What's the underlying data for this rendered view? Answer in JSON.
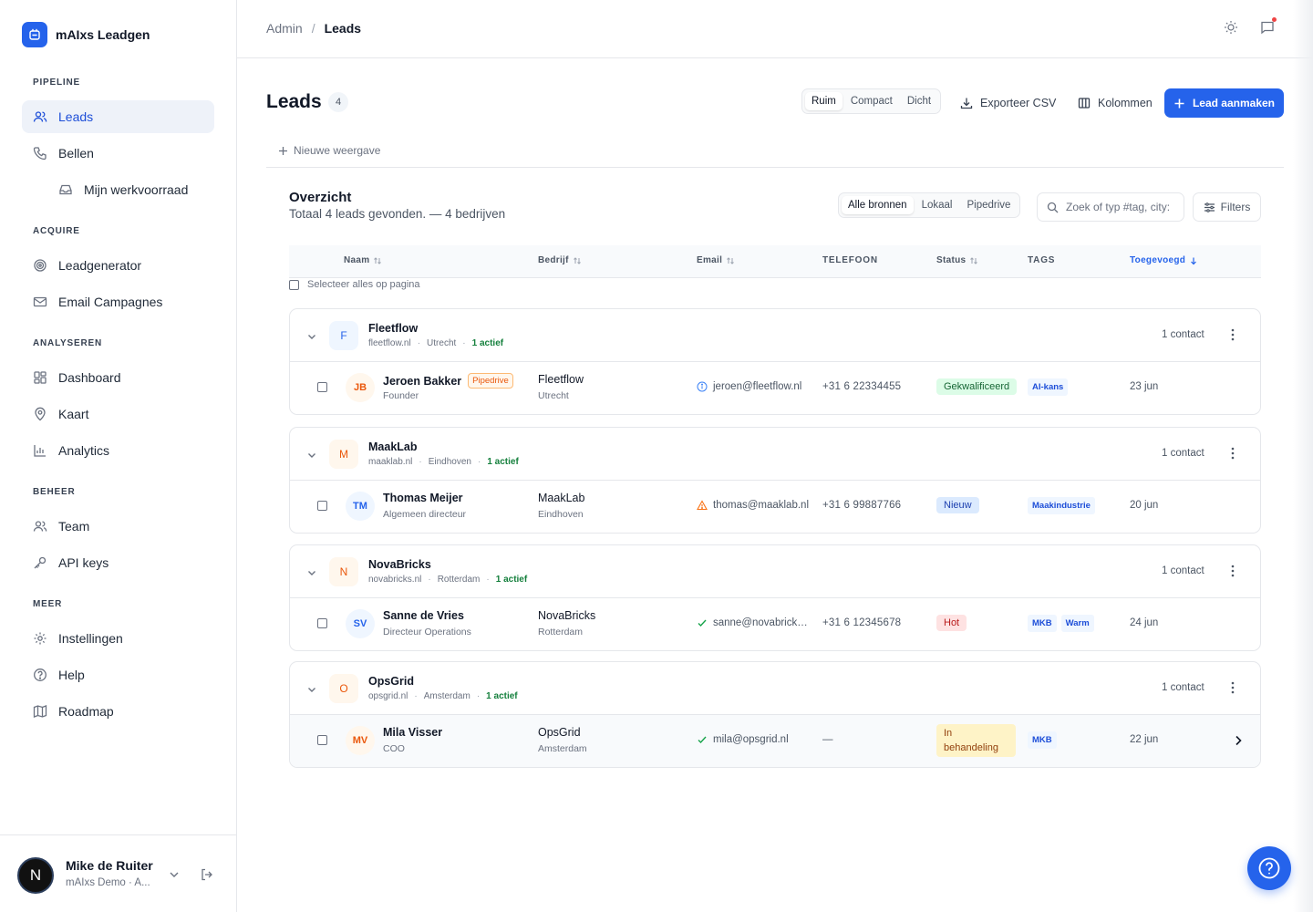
{
  "brand": {
    "name": "mAIxs Leadgen"
  },
  "sidebar": {
    "sections": [
      {
        "title": "PIPELINE",
        "items": [
          {
            "label": "Leads",
            "icon": "users-icon",
            "active": true
          },
          {
            "label": "Bellen",
            "icon": "phone-icon"
          },
          {
            "label": "Mijn werkvoorraad",
            "icon": "inbox-icon"
          }
        ]
      },
      {
        "title": "ACQUIRE",
        "items": [
          {
            "label": "Leadgenerator",
            "icon": "target-icon"
          },
          {
            "label": "Email Campagnes",
            "icon": "mail-icon"
          }
        ]
      },
      {
        "title": "ANALYSEREN",
        "items": [
          {
            "label": "Dashboard",
            "icon": "dashboard-icon"
          },
          {
            "label": "Kaart",
            "icon": "map-pin-icon"
          },
          {
            "label": "Analytics",
            "icon": "bar-chart-icon"
          }
        ]
      },
      {
        "title": "BEHEER",
        "items": [
          {
            "label": "Team",
            "icon": "team-icon"
          },
          {
            "label": "API keys",
            "icon": "key-icon"
          }
        ]
      },
      {
        "title": "MEER",
        "items": [
          {
            "label": "Instellingen",
            "icon": "gear-icon"
          },
          {
            "label": "Help",
            "icon": "help-circle-icon"
          },
          {
            "label": "Roadmap",
            "icon": "map-icon"
          }
        ]
      }
    ],
    "user": {
      "initial": "N",
      "name": "Mike de Ruiter",
      "org": "mAIxs Demo · A..."
    }
  },
  "topbar": {
    "breadcrumb": [
      "Admin",
      "/",
      "Leads"
    ]
  },
  "page": {
    "title": "Leads",
    "count": "4",
    "density": [
      "Ruim",
      "Compact",
      "Dicht"
    ],
    "export_label": "Exporteer CSV",
    "columns_label": "Kolommen",
    "create_label": "Lead aanmaken",
    "new_view_label": "Nieuwe weergave"
  },
  "overview": {
    "title": "Overzicht",
    "subtitle": "Totaal 4 leads gevonden. — 4 bedrijven",
    "sources": [
      "Alle bronnen",
      "Lokaal",
      "Pipedrive"
    ],
    "search_placeholder": "Zoek of typ #tag, city:",
    "filters_label": "Filters"
  },
  "table": {
    "headers": [
      "Naam",
      "Bedrijf",
      "Email",
      "TELEFOON",
      "Status",
      "TAGS",
      "Toegevoegd"
    ],
    "select_all": "Selecteer alles op pagina"
  },
  "groups": [
    {
      "initial": "F",
      "name": "Fleetflow",
      "domain": "fleetflow.nl",
      "city": "Utrecht",
      "active": "1 actief",
      "contacts": "1 contact",
      "lead": {
        "initials": "JB",
        "name": "Jeroen Bakker",
        "badge": "Pipedrive",
        "role": "Founder",
        "company": "Fleetflow",
        "city": "Utrecht",
        "email": "jeroen@fleetflow.nl",
        "email_icon": "info-icon",
        "phone": "+31 6 22334455",
        "status": "Gekwalificeerd",
        "status_color": "#dcfce7",
        "tags": [
          "AI-kans"
        ],
        "date": "23 jun"
      }
    },
    {
      "initial": "M",
      "name": "MaakLab",
      "domain": "maaklab.nl",
      "city": "Eindhoven",
      "active": "1 actief",
      "contacts": "1 contact",
      "lead": {
        "initials": "TM",
        "name": "Thomas Meijer",
        "badge": "",
        "role": "Algemeen directeur",
        "company": "MaakLab",
        "city": "Eindhoven",
        "email": "thomas@maaklab.nl",
        "email_icon": "warning-icon",
        "phone": "+31 6 99887766",
        "status": "Nieuw",
        "status_color": "#dbeafe",
        "tags": [
          "Maakindustrie"
        ],
        "date": "20 jun"
      }
    },
    {
      "initial": "N",
      "name": "NovaBricks",
      "domain": "novabricks.nl",
      "city": "Rotterdam",
      "active": "1 actief",
      "contacts": "1 contact",
      "lead": {
        "initials": "SV",
        "name": "Sanne de Vries",
        "badge": "",
        "role": "Directeur Operations",
        "company": "NovaBricks",
        "city": "Rotterdam",
        "email": "sanne@novabricks.nl",
        "email_icon": "check-icon",
        "phone": "+31 6 12345678",
        "status": "Hot",
        "status_color": "#fee2e2",
        "tags": [
          "MKB",
          "Warm"
        ],
        "date": "24 jun"
      }
    },
    {
      "initial": "O",
      "name": "OpsGrid",
      "domain": "opsgrid.nl",
      "city": "Amsterdam",
      "active": "1 actief",
      "contacts": "1 contact",
      "lead": {
        "initials": "MV",
        "name": "Mila Visser",
        "badge": "",
        "role": "COO",
        "company": "OpsGrid",
        "city": "Amsterdam",
        "email": "mila@opsgrid.nl",
        "email_icon": "check-icon",
        "phone": "—",
        "status": "In behandeling",
        "status_color": "#fef3c7",
        "tags": [
          "MKB"
        ],
        "date": "22 jun"
      }
    }
  ],
  "colors": {
    "accent": "#2563eb",
    "active_green": "#15803d",
    "pipedrive_orange": "#ea580c"
  }
}
